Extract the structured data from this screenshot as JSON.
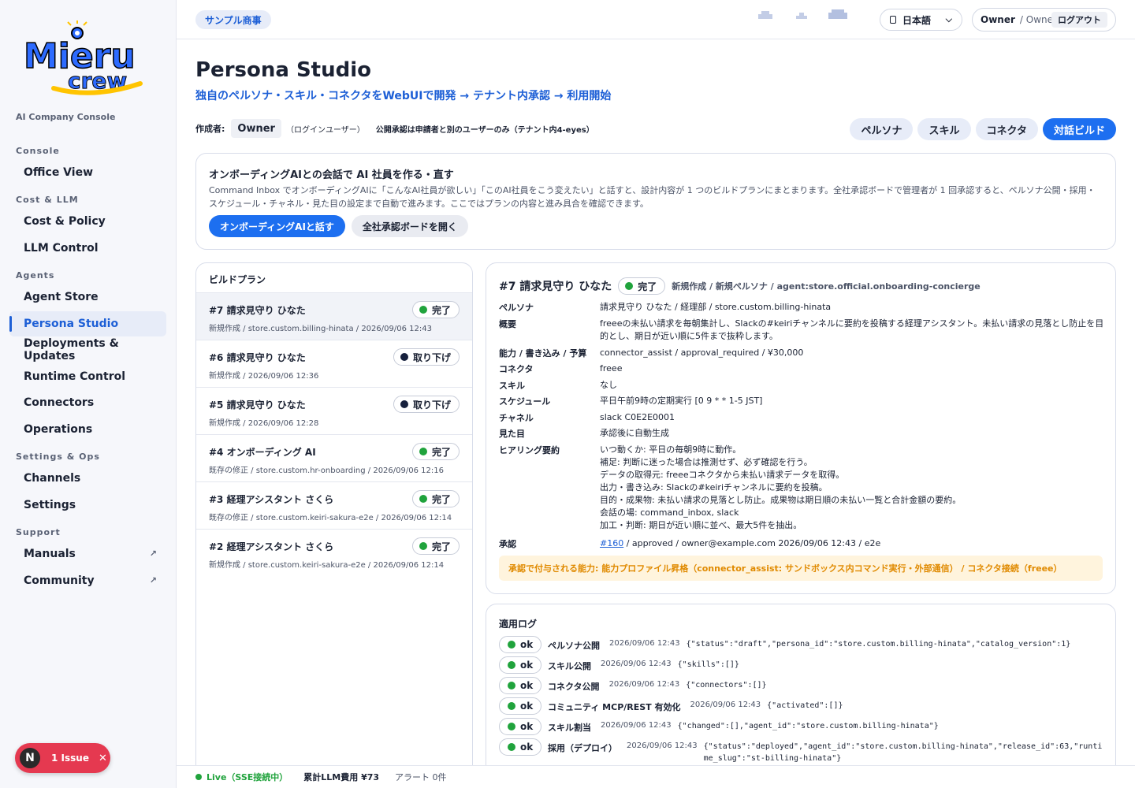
{
  "app": {
    "logo_text": "Mieru crew",
    "console_caption": "AI Company Console"
  },
  "sidebar": {
    "groups": [
      {
        "label": "Console"
      },
      {
        "label": "Cost & LLM"
      },
      {
        "label": "Agents"
      },
      {
        "label": "Settings & Ops"
      },
      {
        "label": "Support"
      }
    ],
    "items": [
      {
        "label": "Office View"
      },
      {
        "label": "Cost & Policy"
      },
      {
        "label": "LLM Control"
      },
      {
        "label": "Agent Store"
      },
      {
        "label": "Persona Studio",
        "active": true
      },
      {
        "label": "Deployments & Updates"
      },
      {
        "label": "Runtime Control"
      },
      {
        "label": "Connectors"
      },
      {
        "label": "Operations"
      },
      {
        "label": "Channels"
      },
      {
        "label": "Settings"
      },
      {
        "label": "Manuals",
        "external_icon": "↗"
      },
      {
        "label": "Community",
        "external_icon": "↗"
      }
    ],
    "issue": {
      "badge": "N",
      "label": "1 Issue",
      "close_icon": "✕"
    }
  },
  "topbar": {
    "tenant": "サンプル商事",
    "language": "日本語",
    "user": {
      "name": "Owner",
      "role": "/ Owner",
      "logout": "ログアウト"
    }
  },
  "page": {
    "title": "Persona Studio",
    "subtitle": "独自のペルソナ・スキル・コネクタをWebUIで開発 → テナント内承認 → 利用開始",
    "author_label": "作成者:",
    "author_value": "Owner",
    "author_note": "（ログインユーザー）",
    "approval_note": "公開承認は申請者と別のユーザーのみ（テナント内4-eyes）",
    "tabs": [
      {
        "label": "ペルソナ"
      },
      {
        "label": "スキル"
      },
      {
        "label": "コネクタ"
      },
      {
        "label": "対話ビルド",
        "active": true
      }
    ]
  },
  "onboarding": {
    "title": "オンボーディングAIとの会話で AI 社員を作る・直す",
    "description": "Command Inbox でオンボーディングAIに「こんなAI社員が欲しい」「このAI社員をこう変えたい」と話すと、設計内容が 1 つのビルドプランにまとまります。全社承認ボードで管理者が 1 回承認すると、ペルソナ公開・採用・スケジュール・チャネル・見た目の設定まで自動で進みます。ここではプランの内容と進み具合を確認できます。",
    "primary_button": "オンボーディングAIと話す",
    "secondary_button": "全社承認ボードを開く"
  },
  "build_plans": {
    "heading": "ビルドプラン",
    "items": [
      {
        "title": "#7 請求見守り ひなた",
        "meta": "新規作成 / store.custom.billing-hinata / 2026/09/06 12:43",
        "status": "完了",
        "status_color": "#20a33c",
        "selected": true
      },
      {
        "title": "#6 請求見守り ひなた",
        "meta": "新規作成 / 2026/09/06 12:36",
        "status": "取り下げ",
        "status_color": "#16203d"
      },
      {
        "title": "#5 請求見守り ひなた",
        "meta": "新規作成 / 2026/09/06 12:28",
        "status": "取り下げ",
        "status_color": "#16203d"
      },
      {
        "title": "#4 オンボーディング AI",
        "meta": "既存の修正 / store.custom.hr-onboarding / 2026/09/06 12:16",
        "status": "完了",
        "status_color": "#20a33c"
      },
      {
        "title": "#3 経理アシスタント さくら",
        "meta": "既存の修正 / store.custom.keiri-sakura-e2e / 2026/09/06 12:14",
        "status": "完了",
        "status_color": "#20a33c"
      },
      {
        "title": "#2 経理アシスタント さくら",
        "meta": "新規作成 / store.custom.keiri-sakura-e2e / 2026/09/06 12:14",
        "status": "完了",
        "status_color": "#20a33c"
      }
    ]
  },
  "detail": {
    "title": "#7 請求見守り ひなた",
    "status": "完了",
    "meta": "新規作成 / 新規ペルソナ / agent:store.official.onboarding-concierge",
    "fields": {
      "persona_label": "ペルソナ",
      "persona": "請求見守り ひなた / 経理部 / store.custom.billing-hinata",
      "summary_label": "概要",
      "summary": "freeeの未払い請求を毎朝集計し、Slackの#keiriチャンネルに要約を投稿する経理アシスタント。未払い請求の見落とし防止を目的とし、期日が近い順に5件まで抜粋します。",
      "capability_label": "能力 / 書き込み / 予算",
      "capability": "connector_assist / approval_required / ¥30,000",
      "connector_label": "コネクタ",
      "connector": "freee",
      "skill_label": "スキル",
      "skill": "なし",
      "schedule_label": "スケジュール",
      "schedule": "平日午前9時の定期実行 [0 9 * * 1-5 JST]",
      "channel_label": "チャネル",
      "channel": "slack C0E2E0001",
      "appearance_label": "見た目",
      "appearance": "承認後に自動生成",
      "hearing_label": "ヒアリング要約",
      "hearing": [
        "いつ動くか: 平日の毎朝9時に動作。",
        "補足: 判断に迷った場合は推測せず、必ず確認を行う。",
        "データの取得元: freeeコネクタから未払い請求データを取得。",
        "出力・書き込み: Slackの#keiriチャンネルに要約を投稿。",
        "目的・成果物: 未払い請求の見落とし防止。成果物は期日順の未払い一覧と合計金額の要約。",
        "会話の場: command_inbox, slack",
        "加工・判断: 期日が近い順に並べ、最大5件を抽出。"
      ],
      "approval_label": "承認",
      "approval_link": "#160",
      "approval_rest": " / approved / owner@example.com 2026/09/06 12:43 / e2e"
    },
    "warning": "承認で付与される能力: 能力プロファイル昇格（connector_assist: サンドボックス内コマンド実行・外部通信） / コネクタ接続（freee）"
  },
  "logs": {
    "heading": "適用ログ",
    "items": [
      {
        "status": "ok",
        "label": "ペルソナ公開",
        "time": "2026/09/06 12:43",
        "json": "{\"status\":\"draft\",\"persona_id\":\"store.custom.billing-hinata\",\"catalog_version\":1}"
      },
      {
        "status": "ok",
        "label": "スキル公開",
        "time": "2026/09/06 12:43",
        "json": "{\"skills\":[]}"
      },
      {
        "status": "ok",
        "label": "コネクタ公開",
        "time": "2026/09/06 12:43",
        "json": "{\"connectors\":[]}"
      },
      {
        "status": "ok",
        "label": "コミュニティ MCP/REST 有効化",
        "time": "2026/09/06 12:43",
        "json": "{\"activated\":[]}"
      },
      {
        "status": "ok",
        "label": "スキル割当",
        "time": "2026/09/06 12:43",
        "json": "{\"changed\":[],\"agent_id\":\"store.custom.billing-hinata\"}"
      },
      {
        "status": "ok",
        "label": "採用（デプロイ）",
        "time": "2026/09/06 12:43",
        "json": "{\"status\":\"deployed\",\"agent_id\":\"store.custom.billing-hinata\",\"release_id\":63,\"runtime_slug\":\"st-billing-hinata\"}"
      }
    ]
  },
  "statusbar": {
    "live": "Live（SSE接続中）",
    "cost": "累計LLM費用 ¥73",
    "alerts": "アラート 0件"
  },
  "colors": {
    "accent": "#1d6ff0",
    "link": "#1d5fd6",
    "ok_green": "#20a33c",
    "warning_text": "#e08a00",
    "warning_bg": "#fff4dd",
    "issue_red": "#e53950"
  }
}
